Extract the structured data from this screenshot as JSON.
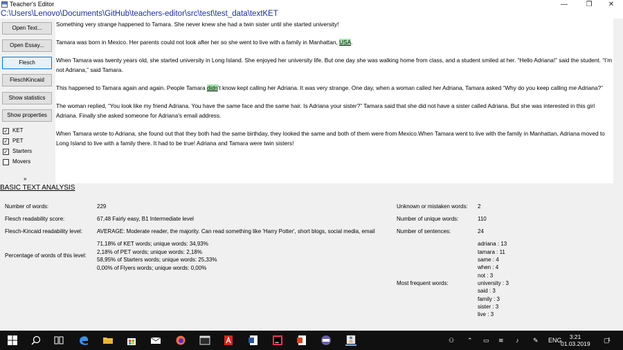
{
  "window": {
    "title": "Teacher's Editor",
    "minimize": "—",
    "maximize": "❐",
    "close": "✕"
  },
  "path": "C:\\Users\\Lenovo\\Documents\\GitHub\\teachers-editor\\src\\test\\test_data\\textKET",
  "sidebar": {
    "buttons": [
      "Open Text...",
      "Open Essay...",
      "Flesch",
      "FleschKincaid",
      "Show statistics",
      "Show properties"
    ],
    "levels": [
      {
        "label": "KET",
        "checked": true
      },
      {
        "label": "PET",
        "checked": true
      },
      {
        "label": "Starters",
        "checked": true
      },
      {
        "label": "Movers",
        "checked": false
      }
    ],
    "expander": "»"
  },
  "text": {
    "p1": "Something very strange happened to Tamara. She never knew she had a twin sister until she started university!",
    "p2a": "Tamara was born in Mexico. Her parents could not look after her so she went to live with a family in Manhattan, ",
    "p2hl": "USA",
    "p2b": ".",
    "p3": "When Tamara was twenty years old, she started university in Long Island. She enjoyed her university life. But one day she was walking home from class, and a student smiled at her. “Hello Adriana!” said the student. “I’m not Adriana,” said Tamara.",
    "p4a": "This happened to Tamara again and again. People Tamara ",
    "p4hl": "didn",
    "p4b": "’t know kept calling her Adriana. It was very strange. One day, when a woman called her Adriana, Tamara asked “Why do you keep calling me Adriana?”",
    "p5": "The woman replied, “You look like my friend Adriana. You have the same face and the same hair. Is Adriana your sister?” Tamara said that she did not have a sister called Adriana. But she was interested in this girl Adriana. Finally she asked someone for Adriana’s email address.",
    "p6": "When Tamara wrote to Adriana, she found out that they both had the same birthday, they looked the same and both of them were from Mexico.When Tamara went to live with the family in Manhattan, Adriana moved to Long Island to live with a family there. It had to be true! Adriana and Tamara were twin sisters!"
  },
  "analysis": {
    "heading": "BASIC TEXT ANALYSIS",
    "words_label": "Number of words:",
    "words_value": "229",
    "flesch_label": "Flesch readability score:",
    "flesch_value": "67,48 Fairly easy, B1 Intermediate level",
    "fk_label": "Flesch-Kincaid readability level:",
    "fk_value": "AVERAGE: Moderate reader, the majority. Can read something like 'Harry Potter', short blogs, social media, email",
    "pct_label": "Percentage of words of this level:",
    "pct_lines": [
      "71,18% of KET words;  unique words: 34,93%",
      "2,18% of PET words;  unique words: 2,18%",
      "58,95% of Starters words;  unique words: 25,33%",
      "0,00% of Flyers words;  unique words: 0,00%"
    ],
    "unknown_label": "Unknown or mistaken words:",
    "unknown_value": "2",
    "unique_label": "Number of unique words:",
    "unique_value": "110",
    "sentences_label": "Number of sentences:",
    "sentences_value": "24",
    "frequent_label": "Most frequent words:",
    "frequent": [
      "adriana : 13",
      "tamara : 11",
      "same : 4",
      "when : 4",
      "not : 3",
      "university : 3",
      "said : 3",
      "family : 3",
      "sister : 3",
      "live : 3"
    ]
  },
  "taskbar": {
    "language": "ENG",
    "time": "3:21",
    "date": "01.03.2019",
    "notifications": "1"
  }
}
